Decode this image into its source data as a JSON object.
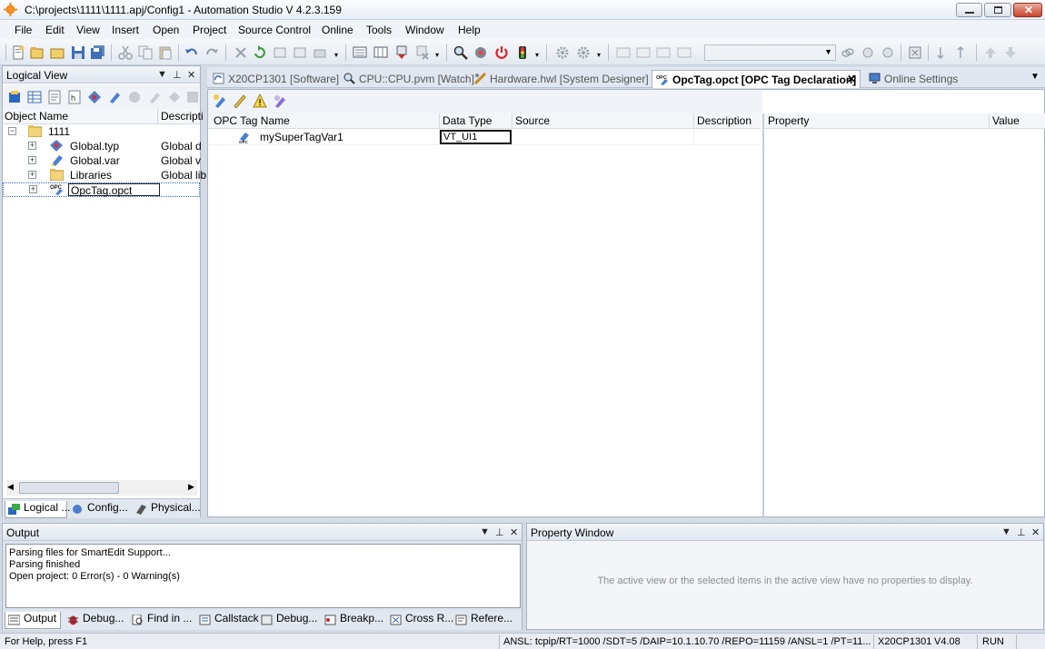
{
  "window": {
    "title": "C:\\projects\\1111\\1111.apj/Config1 - Automation Studio V 4.2.3.159"
  },
  "menu": [
    "File",
    "Edit",
    "View",
    "Insert",
    "Open",
    "Project",
    "Source Control",
    "Online",
    "Tools",
    "Window",
    "Help"
  ],
  "logical_view": {
    "title": "Logical View",
    "col_object_name": "Object Name",
    "col_description": "Descripti",
    "tree": [
      {
        "name": "1111",
        "desc": "",
        "icon": "folder-icon"
      },
      {
        "name": "Global.typ",
        "desc": "Global d",
        "icon": "global-type-icon"
      },
      {
        "name": "Global.var",
        "desc": "Global v",
        "icon": "global-var-icon"
      },
      {
        "name": "Libraries",
        "desc": "Global lib",
        "icon": "folder-icon"
      },
      {
        "name": "OpcTag.opct",
        "desc": "",
        "icon": "opc-tag-icon"
      }
    ],
    "tabs": [
      "Logical ...",
      "Config...",
      "Physical..."
    ]
  },
  "doc_tabs": [
    "X20CP1301 [Software]",
    "CPU::CPU.pvm [Watch]",
    "Hardware.hwl [System Designer]",
    "OpcTag.opct [OPC Tag Declaration]",
    "Online Settings"
  ],
  "editor": {
    "columns": [
      "OPC Tag Name",
      "Data Type",
      "Source",
      "Description"
    ],
    "rows": [
      {
        "name": "mySuperTagVar1",
        "type": "VT_UI1",
        "source": "",
        "description": ""
      }
    ],
    "prop_columns": [
      "Property",
      "Value"
    ]
  },
  "output": {
    "title": "Output",
    "lines": [
      "Parsing files for SmartEdit Support...",
      "Parsing finished",
      "Open project: 0 Error(s) - 0 Warning(s)"
    ],
    "tabs": [
      "Output",
      "Debug...",
      "Find in ...",
      "Callstack",
      "Debug...",
      "Breakp...",
      "Cross R...",
      "Refere..."
    ]
  },
  "property_window": {
    "title": "Property Window",
    "message": "The active view or the selected items in the active view have no properties to display."
  },
  "status": {
    "help": "For Help, press F1",
    "connection": "ANSL: tcpip/RT=1000 /SDT=5 /DAIP=10.1.10.70 /REPO=11159 /ANSL=1 /PT=11...",
    "cpu": "X20CP1301",
    "version": "V4.08",
    "mode": "RUN"
  }
}
